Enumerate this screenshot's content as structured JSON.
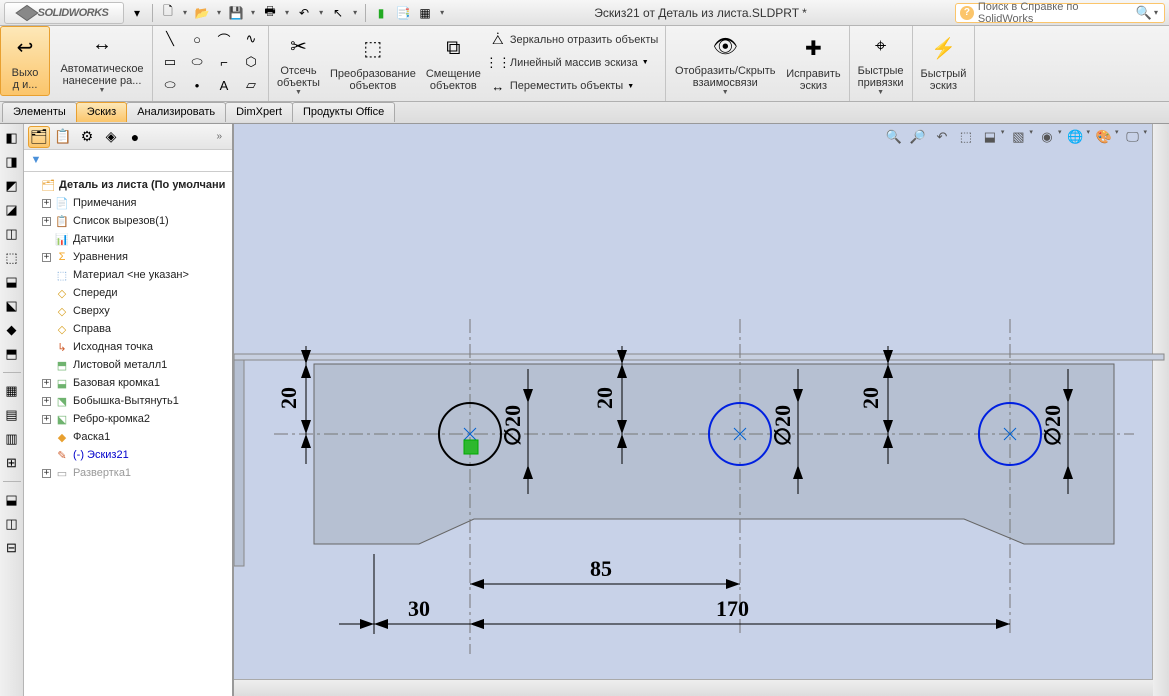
{
  "brand": "SOLIDWORKS",
  "title": "Эскиз21 от Деталь из листа.SLDPRT *",
  "search_placeholder": "Поиск в Справке по SolidWorks",
  "ribbon": {
    "exit": "Выхо\nд и...",
    "autodim": "Автоматическое\nнанесение ра...",
    "trim": "Отсечь\nобъекты",
    "convert": "Преобразование\nобъектов",
    "offset": "Смещение\nобъектов",
    "mirror": "Зеркально отразить объекты",
    "linear": "Линейный массив эскиза",
    "move": "Переместить объекты",
    "showhide": "Отобразить/Скрыть\nвзаимосвязи",
    "repair": "Исправить\nэскиз",
    "quicksnap": "Быстрые\nпривязки",
    "quicksketch": "Быстрый\nэскиз"
  },
  "tabs": [
    "Элементы",
    "Эскиз",
    "Анализировать",
    "DimXpert",
    "Продукты Office"
  ],
  "active_tab": 1,
  "tree": {
    "root": "Деталь из листа  (По умолчани",
    "items": [
      {
        "pm": "+",
        "icon": "📄",
        "txt": "Примечания",
        "color": "#f5a623"
      },
      {
        "pm": "+",
        "icon": "📋",
        "txt": "Список вырезов(1)",
        "color": "#6fb36f"
      },
      {
        "pm": " ",
        "icon": "📊",
        "txt": "Датчики",
        "color": "#f5a623"
      },
      {
        "pm": "+",
        "icon": "Σ",
        "txt": "Уравнения",
        "color": "#f5a623"
      },
      {
        "pm": " ",
        "icon": "⬚",
        "txt": "Материал <не указан>",
        "color": "#7aa8d8"
      },
      {
        "pm": " ",
        "icon": "◇",
        "txt": "Спереди",
        "color": "#d8a020"
      },
      {
        "pm": " ",
        "icon": "◇",
        "txt": "Сверху",
        "color": "#d8a020"
      },
      {
        "pm": " ",
        "icon": "◇",
        "txt": "Справа",
        "color": "#d8a020"
      },
      {
        "pm": " ",
        "icon": "↳",
        "txt": "Исходная точка",
        "color": "#d06030"
      },
      {
        "pm": " ",
        "icon": "⬒",
        "txt": "Листовой металл1",
        "color": "#6fb36f"
      },
      {
        "pm": "+",
        "icon": "⬓",
        "txt": "Базовая кромка1",
        "color": "#6fb36f"
      },
      {
        "pm": "+",
        "icon": "⬔",
        "txt": "Бобышка-Вытянуть1",
        "color": "#6fb36f"
      },
      {
        "pm": "+",
        "icon": "⬕",
        "txt": "Ребро-кромка2",
        "color": "#6fb36f"
      },
      {
        "pm": " ",
        "icon": "◆",
        "txt": "Фаска1",
        "color": "#e8a030"
      },
      {
        "pm": " ",
        "icon": "✎",
        "txt": "(-) Эскиз21",
        "color": "#d06030",
        "blue": true
      },
      {
        "pm": "+",
        "icon": "▭",
        "txt": "Развертка1",
        "color": "#999",
        "grey": true
      }
    ]
  },
  "dims": {
    "v20a": "20",
    "dia1": "∅20",
    "v20b": "20",
    "dia2": "∅20",
    "v20c": "20",
    "dia3": "∅20",
    "h30": "30",
    "h85": "85",
    "h170": "170"
  }
}
